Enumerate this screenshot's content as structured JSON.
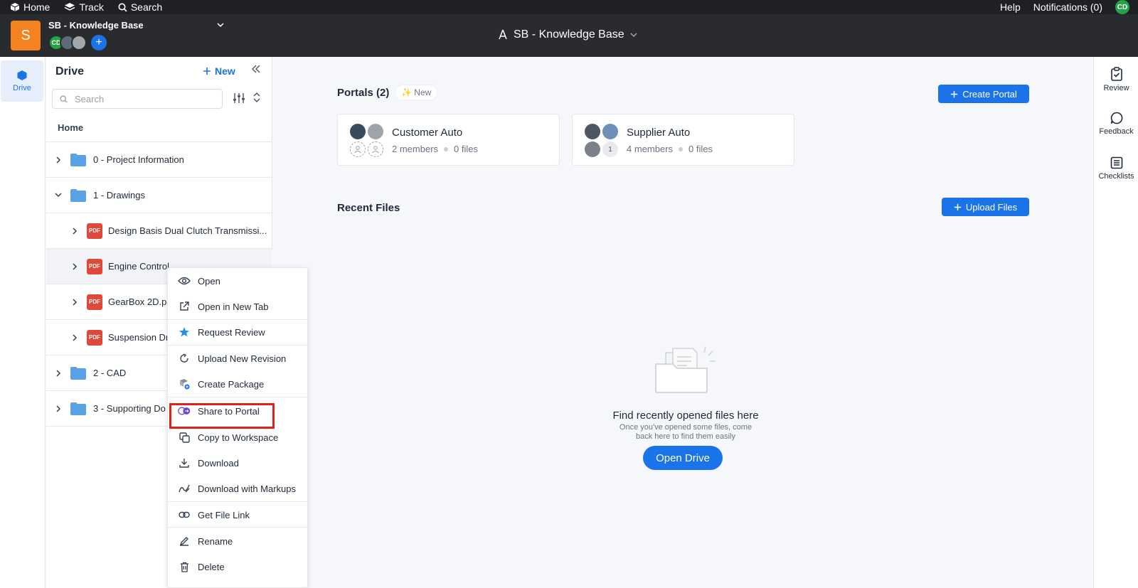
{
  "topnav": {
    "home": "Home",
    "track": "Track",
    "search": "Search",
    "help": "Help",
    "notifications": "Notifications (0)",
    "user_initials": "CD"
  },
  "project": {
    "logo_letter": "S",
    "name": "SB - Knowledge Base",
    "member_initials": "CD",
    "center_title": "SB - Knowledge Base"
  },
  "leftrail": {
    "drive_label": "Drive"
  },
  "drivepanel": {
    "title": "Drive",
    "new_label": "New",
    "search_placeholder": "Search",
    "home_label": "Home",
    "tree": [
      {
        "label": "0 - Project Information",
        "type": "folder",
        "expanded": false
      },
      {
        "label": "1 - Drawings",
        "type": "folder",
        "expanded": true
      },
      {
        "label": "Design Basis Dual Clutch Transmissi...",
        "type": "pdf"
      },
      {
        "label": "Engine Control",
        "type": "pdf"
      },
      {
        "label": "GearBox 2D.pdf",
        "type": "pdf"
      },
      {
        "label": "Suspension Dr",
        "type": "pdf"
      },
      {
        "label": "2 - CAD",
        "type": "folder",
        "expanded": false
      },
      {
        "label": "3 - Supporting Do",
        "type": "folder",
        "expanded": false
      }
    ],
    "pdf_badge": "PDF"
  },
  "main": {
    "portals_title": "Portals (2)",
    "new_badge": "✨ New",
    "create_portal": "Create Portal",
    "portals": [
      {
        "name": "Customer Auto",
        "members": "2 members",
        "files": "0 files"
      },
      {
        "name": "Supplier Auto",
        "members": "4 members",
        "files": "0 files",
        "extra_count": "1"
      }
    ],
    "recent_title": "Recent Files",
    "upload_files": "Upload Files",
    "empty_title": "Find recently opened files here",
    "empty_sub": "Once you've opened some files, come back here to find them easily",
    "open_drive": "Open Drive"
  },
  "rightrail": {
    "review": "Review",
    "feedback": "Feedback",
    "checklists": "Checklists"
  },
  "context_menu": [
    {
      "label": "Open",
      "icon": "eye-icon"
    },
    {
      "label": "Open in New Tab",
      "icon": "external-link-icon"
    },
    {
      "label": "Request Review",
      "icon": "star-icon"
    },
    {
      "label": "Upload New Revision",
      "icon": "revision-icon"
    },
    {
      "label": "Create Package",
      "icon": "package-icon"
    },
    {
      "label": "Share to Portal",
      "icon": "share-portal-icon"
    },
    {
      "label": "Copy to Workspace",
      "icon": "copy-icon"
    },
    {
      "label": "Download",
      "icon": "download-icon"
    },
    {
      "label": "Download with Markups",
      "icon": "markup-icon"
    },
    {
      "label": "Get File Link",
      "icon": "link-icon"
    },
    {
      "label": "Rename",
      "icon": "pencil-icon"
    },
    {
      "label": "Delete",
      "icon": "trash-icon"
    }
  ],
  "colors": {
    "accent": "#1a73e8",
    "brand_orange": "#f58220",
    "highlight_red": "#e0201b",
    "pdf_red": "#e0483a",
    "folder_blue": "#5aa2e6"
  }
}
